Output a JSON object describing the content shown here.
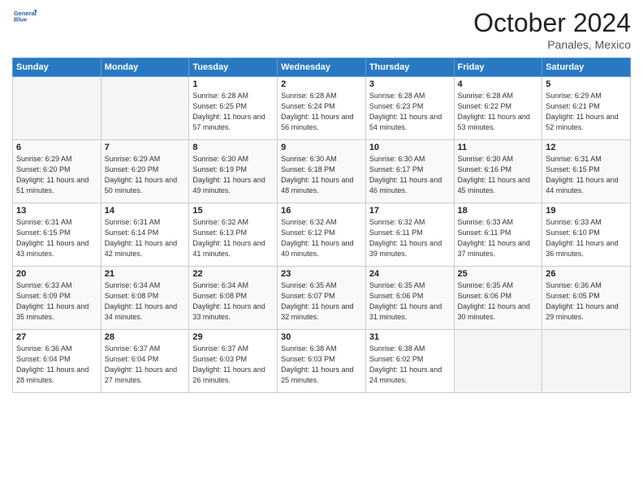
{
  "header": {
    "logo_line1": "General",
    "logo_line2": "Blue",
    "month": "October 2024",
    "location": "Panales, Mexico"
  },
  "weekdays": [
    "Sunday",
    "Monday",
    "Tuesday",
    "Wednesday",
    "Thursday",
    "Friday",
    "Saturday"
  ],
  "weeks": [
    [
      {
        "day": "",
        "empty": true
      },
      {
        "day": "",
        "empty": true
      },
      {
        "day": "1",
        "sunrise": "6:28 AM",
        "sunset": "6:25 PM",
        "daylight": "11 hours and 57 minutes."
      },
      {
        "day": "2",
        "sunrise": "6:28 AM",
        "sunset": "6:24 PM",
        "daylight": "11 hours and 56 minutes."
      },
      {
        "day": "3",
        "sunrise": "6:28 AM",
        "sunset": "6:23 PM",
        "daylight": "11 hours and 54 minutes."
      },
      {
        "day": "4",
        "sunrise": "6:28 AM",
        "sunset": "6:22 PM",
        "daylight": "11 hours and 53 minutes."
      },
      {
        "day": "5",
        "sunrise": "6:29 AM",
        "sunset": "6:21 PM",
        "daylight": "11 hours and 52 minutes."
      }
    ],
    [
      {
        "day": "6",
        "sunrise": "6:29 AM",
        "sunset": "6:20 PM",
        "daylight": "11 hours and 51 minutes."
      },
      {
        "day": "7",
        "sunrise": "6:29 AM",
        "sunset": "6:20 PM",
        "daylight": "11 hours and 50 minutes."
      },
      {
        "day": "8",
        "sunrise": "6:30 AM",
        "sunset": "6:19 PM",
        "daylight": "11 hours and 49 minutes."
      },
      {
        "day": "9",
        "sunrise": "6:30 AM",
        "sunset": "6:18 PM",
        "daylight": "11 hours and 48 minutes."
      },
      {
        "day": "10",
        "sunrise": "6:30 AM",
        "sunset": "6:17 PM",
        "daylight": "11 hours and 46 minutes."
      },
      {
        "day": "11",
        "sunrise": "6:30 AM",
        "sunset": "6:16 PM",
        "daylight": "11 hours and 45 minutes."
      },
      {
        "day": "12",
        "sunrise": "6:31 AM",
        "sunset": "6:15 PM",
        "daylight": "11 hours and 44 minutes."
      }
    ],
    [
      {
        "day": "13",
        "sunrise": "6:31 AM",
        "sunset": "6:15 PM",
        "daylight": "11 hours and 43 minutes."
      },
      {
        "day": "14",
        "sunrise": "6:31 AM",
        "sunset": "6:14 PM",
        "daylight": "11 hours and 42 minutes."
      },
      {
        "day": "15",
        "sunrise": "6:32 AM",
        "sunset": "6:13 PM",
        "daylight": "11 hours and 41 minutes."
      },
      {
        "day": "16",
        "sunrise": "6:32 AM",
        "sunset": "6:12 PM",
        "daylight": "11 hours and 40 minutes."
      },
      {
        "day": "17",
        "sunrise": "6:32 AM",
        "sunset": "6:11 PM",
        "daylight": "11 hours and 39 minutes."
      },
      {
        "day": "18",
        "sunrise": "6:33 AM",
        "sunset": "6:11 PM",
        "daylight": "11 hours and 37 minutes."
      },
      {
        "day": "19",
        "sunrise": "6:33 AM",
        "sunset": "6:10 PM",
        "daylight": "11 hours and 36 minutes."
      }
    ],
    [
      {
        "day": "20",
        "sunrise": "6:33 AM",
        "sunset": "6:09 PM",
        "daylight": "11 hours and 35 minutes."
      },
      {
        "day": "21",
        "sunrise": "6:34 AM",
        "sunset": "6:08 PM",
        "daylight": "11 hours and 34 minutes."
      },
      {
        "day": "22",
        "sunrise": "6:34 AM",
        "sunset": "6:08 PM",
        "daylight": "11 hours and 33 minutes."
      },
      {
        "day": "23",
        "sunrise": "6:35 AM",
        "sunset": "6:07 PM",
        "daylight": "11 hours and 32 minutes."
      },
      {
        "day": "24",
        "sunrise": "6:35 AM",
        "sunset": "6:06 PM",
        "daylight": "11 hours and 31 minutes."
      },
      {
        "day": "25",
        "sunrise": "6:35 AM",
        "sunset": "6:06 PM",
        "daylight": "11 hours and 30 minutes."
      },
      {
        "day": "26",
        "sunrise": "6:36 AM",
        "sunset": "6:05 PM",
        "daylight": "11 hours and 29 minutes."
      }
    ],
    [
      {
        "day": "27",
        "sunrise": "6:36 AM",
        "sunset": "6:04 PM",
        "daylight": "11 hours and 28 minutes."
      },
      {
        "day": "28",
        "sunrise": "6:37 AM",
        "sunset": "6:04 PM",
        "daylight": "11 hours and 27 minutes."
      },
      {
        "day": "29",
        "sunrise": "6:37 AM",
        "sunset": "6:03 PM",
        "daylight": "11 hours and 26 minutes."
      },
      {
        "day": "30",
        "sunrise": "6:38 AM",
        "sunset": "6:03 PM",
        "daylight": "11 hours and 25 minutes."
      },
      {
        "day": "31",
        "sunrise": "6:38 AM",
        "sunset": "6:02 PM",
        "daylight": "11 hours and 24 minutes."
      },
      {
        "day": "",
        "empty": true
      },
      {
        "day": "",
        "empty": true
      }
    ]
  ],
  "labels": {
    "sunrise": "Sunrise:",
    "sunset": "Sunset:",
    "daylight": "Daylight:"
  }
}
